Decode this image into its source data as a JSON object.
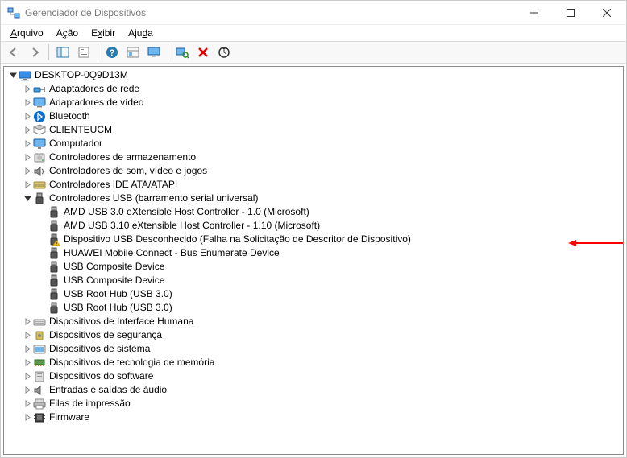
{
  "window": {
    "title": "Gerenciador de Dispositivos"
  },
  "menu": {
    "items": [
      {
        "label": "Arquivo",
        "underline": 0
      },
      {
        "label": "Ação",
        "underline": 1
      },
      {
        "label": "Exibir",
        "underline": 1
      },
      {
        "label": "Ajuda",
        "underline": 3
      }
    ]
  },
  "toolbar": {
    "buttons": [
      {
        "name": "back-icon"
      },
      {
        "name": "forward-icon"
      },
      {
        "sep": true
      },
      {
        "name": "show-hide-tree-icon"
      },
      {
        "name": "properties-icon"
      },
      {
        "sep": true
      },
      {
        "name": "help-icon"
      },
      {
        "name": "show-hidden-icon"
      },
      {
        "name": "monitor-icon"
      },
      {
        "sep": true
      },
      {
        "name": "scan-hardware-icon"
      },
      {
        "name": "remove-device-icon"
      },
      {
        "name": "update-driver-icon"
      }
    ]
  },
  "tree": {
    "root": {
      "label": "DESKTOP-0Q9D13M",
      "icon": "computer-root",
      "expanded": true,
      "children": [
        {
          "label": "Adaptadores de rede",
          "icon": "network",
          "expanded": false,
          "hasChildren": true
        },
        {
          "label": "Adaptadores de vídeo",
          "icon": "display",
          "expanded": false,
          "hasChildren": true
        },
        {
          "label": "Bluetooth",
          "icon": "bluetooth",
          "expanded": false,
          "hasChildren": true
        },
        {
          "label": "CLIENTEUCM",
          "icon": "generic",
          "expanded": false,
          "hasChildren": true
        },
        {
          "label": "Computador",
          "icon": "monitor",
          "expanded": false,
          "hasChildren": true
        },
        {
          "label": "Controladores de armazenamento",
          "icon": "storage",
          "expanded": false,
          "hasChildren": true
        },
        {
          "label": "Controladores de som, vídeo e jogos",
          "icon": "sound",
          "expanded": false,
          "hasChildren": true
        },
        {
          "label": "Controladores IDE ATA/ATAPI",
          "icon": "ide",
          "expanded": false,
          "hasChildren": true
        },
        {
          "label": "Controladores USB (barramento serial universal)",
          "icon": "usb",
          "expanded": true,
          "hasChildren": true,
          "children": [
            {
              "label": "AMD USB 3.0 eXtensible Host Controller - 1.0 (Microsoft)",
              "icon": "usb"
            },
            {
              "label": "AMD USB 3.10 eXtensible Host Controller - 1.10 (Microsoft)",
              "icon": "usb"
            },
            {
              "label": "Dispositivo USB Desconhecido (Falha na Solicitação de Descritor de Dispositivo)",
              "icon": "usb-warn",
              "highlight": true
            },
            {
              "label": "HUAWEI Mobile Connect - Bus Enumerate Device",
              "icon": "usb"
            },
            {
              "label": "USB Composite Device",
              "icon": "usb"
            },
            {
              "label": "USB Composite Device",
              "icon": "usb"
            },
            {
              "label": "USB Root Hub (USB 3.0)",
              "icon": "usb"
            },
            {
              "label": "USB Root Hub (USB 3.0)",
              "icon": "usb"
            }
          ]
        },
        {
          "label": "Dispositivos de Interface Humana",
          "icon": "hid",
          "expanded": false,
          "hasChildren": true
        },
        {
          "label": "Dispositivos de segurança",
          "icon": "security",
          "expanded": false,
          "hasChildren": true
        },
        {
          "label": "Dispositivos de sistema",
          "icon": "system",
          "expanded": false,
          "hasChildren": true
        },
        {
          "label": "Dispositivos de tecnologia de memória",
          "icon": "memory",
          "expanded": false,
          "hasChildren": true
        },
        {
          "label": "Dispositivos do software",
          "icon": "software",
          "expanded": false,
          "hasChildren": true
        },
        {
          "label": "Entradas e saídas de áudio",
          "icon": "audio",
          "expanded": false,
          "hasChildren": true
        },
        {
          "label": "Filas de impressão",
          "icon": "printer",
          "expanded": false,
          "hasChildren": true
        },
        {
          "label": "Firmware",
          "icon": "firmware",
          "expanded": false,
          "hasChildren": true
        }
      ]
    }
  }
}
